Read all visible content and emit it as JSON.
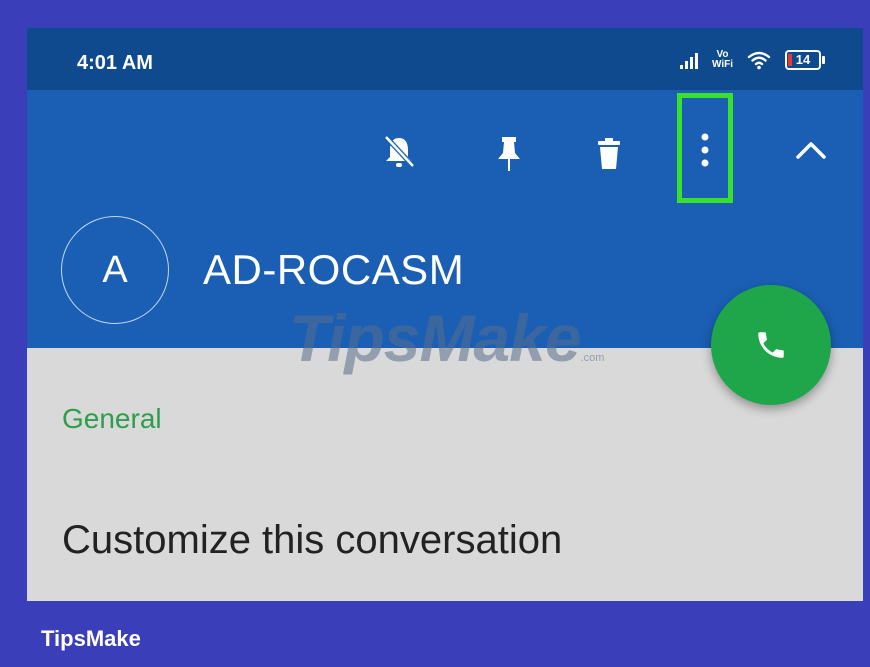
{
  "status_bar": {
    "time": "4:01 AM",
    "vowifi_top": "Vo",
    "vowifi_bottom": "WiFi",
    "battery": "14"
  },
  "toolbar": {
    "icons": [
      "bell-off-icon",
      "pin-icon",
      "trash-icon",
      "more-vertical-icon",
      "chevron-up-icon"
    ],
    "highlight_color": "#39e02c"
  },
  "contact": {
    "avatar_initial": "A",
    "name": "AD-ROCASM"
  },
  "content": {
    "section_label": "General",
    "customize_label": "Customize this conversation"
  },
  "watermark": {
    "text": "TipsMake",
    "domain": ".com"
  },
  "footer": {
    "brand": "TipsMake"
  },
  "colors": {
    "app_bar": "#1a5fb4",
    "status_bar": "#0f4a8f",
    "fab": "#1fa64a",
    "section_label": "#2e9e4a",
    "page_border": "#3a3fb9"
  }
}
